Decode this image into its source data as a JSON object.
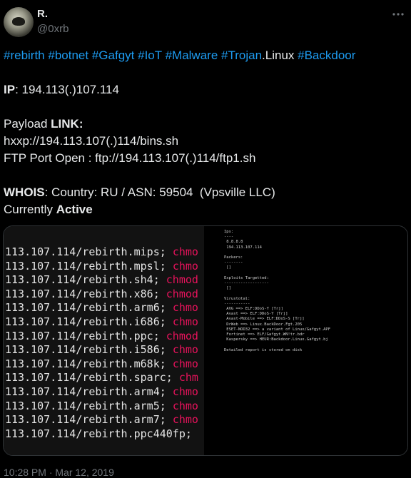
{
  "author": {
    "name": "R.",
    "handle": "@0xrb"
  },
  "tags": [
    {
      "text": "#rebirth",
      "sep": " "
    },
    {
      "text": "#botnet",
      "sep": " "
    },
    {
      "text": "#Gafgyt",
      "sep": " "
    },
    {
      "text": "#IoT",
      "sep": " "
    },
    {
      "text": "#Malware",
      "sep": " "
    },
    {
      "text": "#Trojan",
      "sep": ""
    }
  ],
  "tags_mid": ".Linux ",
  "tags_last": "#Backdoor",
  "ip": {
    "label": "IP",
    "value": ": 194.113(.)107.114"
  },
  "payload": {
    "prefix": "Payload ",
    "label": "LINK:"
  },
  "url1": "hxxp://194.113.107(.)114/bins.sh",
  "url2": "FTP Port Open : ftp://194.113.107(.)114/ftp1.sh",
  "whois": {
    "label": "WHOIS",
    "value": ": Country: RU / ASN: 59504  (Vpsville LLC)"
  },
  "status": {
    "prefix": "Currently ",
    "value": "Active"
  },
  "code_lines": [
    {
      "path": "113.107.114/rebirth.mips",
      "sep": "; ",
      "cmd": "chmo"
    },
    {
      "path": "113.107.114/rebirth.mpsl",
      "sep": "; ",
      "cmd": "chmo"
    },
    {
      "path": "113.107.114/rebirth.sh4",
      "sep": "; ",
      "cmd": "chmod"
    },
    {
      "path": "113.107.114/rebirth.x86",
      "sep": "; ",
      "cmd": "chmod"
    },
    {
      "path": "113.107.114/rebirth.arm6",
      "sep": "; ",
      "cmd": "chmo"
    },
    {
      "path": "113.107.114/rebirth.i686",
      "sep": "; ",
      "cmd": "chmo"
    },
    {
      "path": "113.107.114/rebirth.ppc",
      "sep": "; ",
      "cmd": "chmod"
    },
    {
      "path": "113.107.114/rebirth.i586",
      "sep": "; ",
      "cmd": "chmo"
    },
    {
      "path": "113.107.114/rebirth.m68k",
      "sep": "; ",
      "cmd": "chmo"
    },
    {
      "path": "113.107.114/rebirth.sparc",
      "sep": "; ",
      "cmd": "chm"
    },
    {
      "path": "113.107.114/rebirth.arm4",
      "sep": "; ",
      "cmd": "chmo"
    },
    {
      "path": "113.107.114/rebirth.arm5",
      "sep": "; ",
      "cmd": "chmo"
    },
    {
      "path": "113.107.114/rebirth.arm7",
      "sep": "; ",
      "cmd": "chmo"
    },
    {
      "path": "113.107.114/rebirth.ppc440fp",
      "sep": "; ",
      "cmd": ""
    }
  ],
  "terminal_lines": [
    "Ips:",
    "----",
    " 8.8.8.8",
    " 194.113.107.114",
    "",
    "Packers:",
    "--------",
    " []",
    "",
    "Exploits Targetted:",
    "-------------------",
    " []",
    "",
    "Virustotal:",
    "-----------",
    " AVG ==> ELF:DDoS-Y [Trj]",
    " Avast ==> ELF:DDoS-Y [Trj]",
    " Avast-Mobile ==> ELF:DDoS-S [Trj]",
    " DrWeb ==> Linux.BackDoor.Fgt.205",
    " ESET-NOD32 ==> a variant of Linux/Gafgyt.APF",
    " Fortinet ==> ELF/Gafgyt.WN!tr.bdr",
    " Kaspersky ==> HEUR:Backdoor.Linux.Gafgyt.bj",
    "",
    "Detailed report is stored on disk"
  ],
  "timestamp": "10:28 PM · Mar 12, 2019",
  "colors": {
    "link": "#1d9bf0",
    "text": "#e7e9ea",
    "muted": "#71767b",
    "code_accent": "#e8125c"
  },
  "icons": {
    "more": "more-horizontal-icon"
  }
}
